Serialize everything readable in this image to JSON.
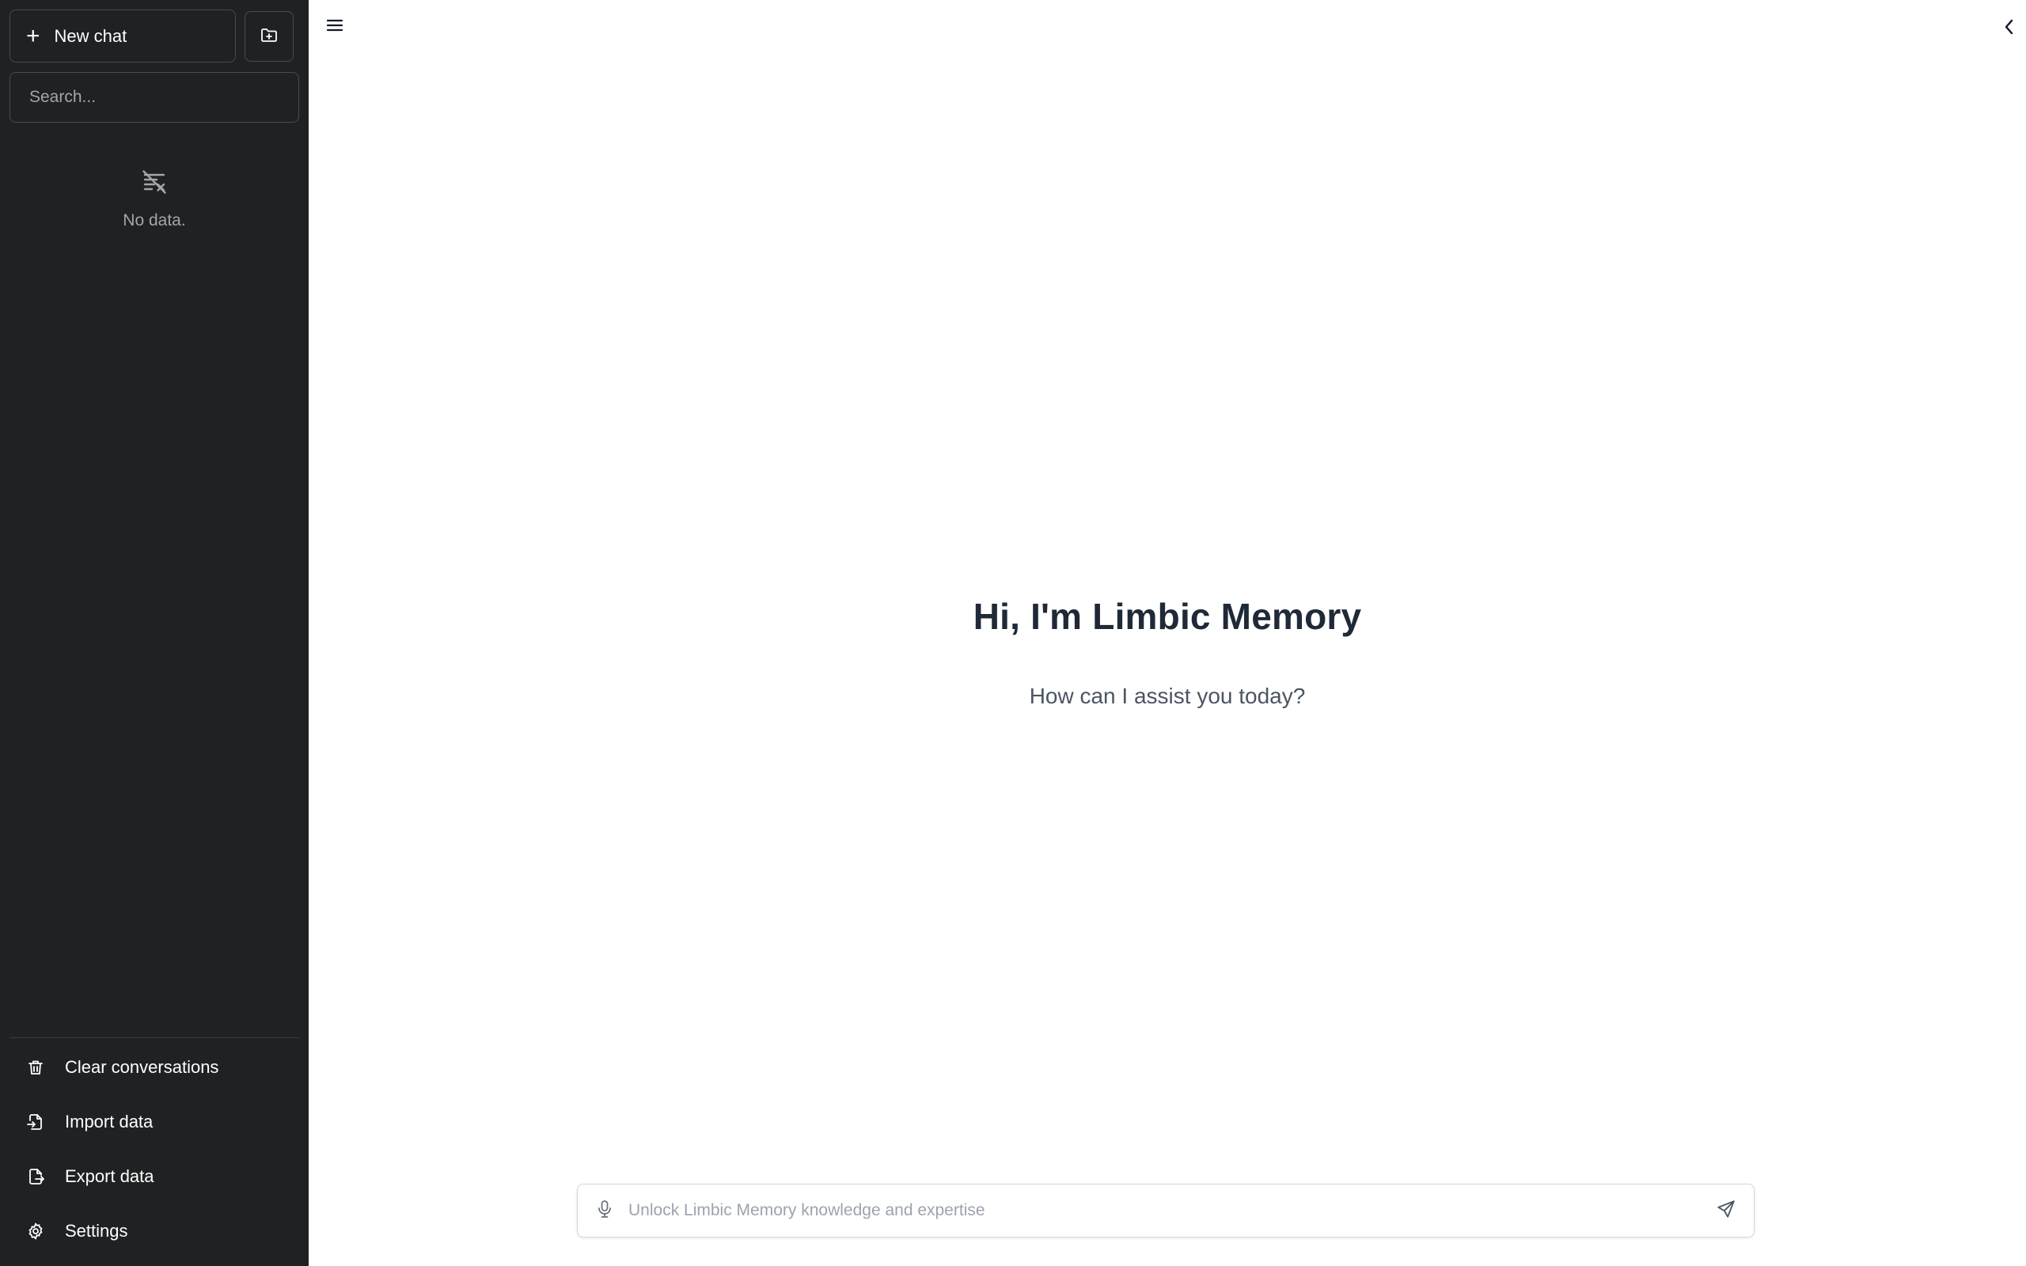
{
  "sidebar": {
    "new_chat_label": "New chat",
    "new_chat_icon": "plus-icon",
    "new_folder_icon": "folder-plus-icon",
    "search_placeholder": "Search...",
    "search_value": "",
    "empty_icon": "no-data-icon",
    "empty_text": "No data.",
    "menu": [
      {
        "label": "Clear conversations",
        "icon": "trash-icon"
      },
      {
        "label": "Import data",
        "icon": "file-import-icon"
      },
      {
        "label": "Export data",
        "icon": "file-export-icon"
      },
      {
        "label": "Settings",
        "icon": "gear-icon"
      }
    ]
  },
  "header": {
    "menu_icon": "hamburger-icon",
    "collapse_icon": "chevron-left-icon"
  },
  "main": {
    "title": "Hi, I'm Limbic Memory",
    "subtitle": "How can I assist you today?"
  },
  "composer": {
    "placeholder": "Unlock Limbic Memory knowledge and expertise",
    "value": "",
    "mic_icon": "microphone-icon",
    "send_icon": "send-icon"
  },
  "colors": {
    "sidebar_bg": "#202123",
    "sidebar_border": "#4a4b50",
    "title_text": "#1f2937",
    "subtitle_text": "#4b5563"
  }
}
